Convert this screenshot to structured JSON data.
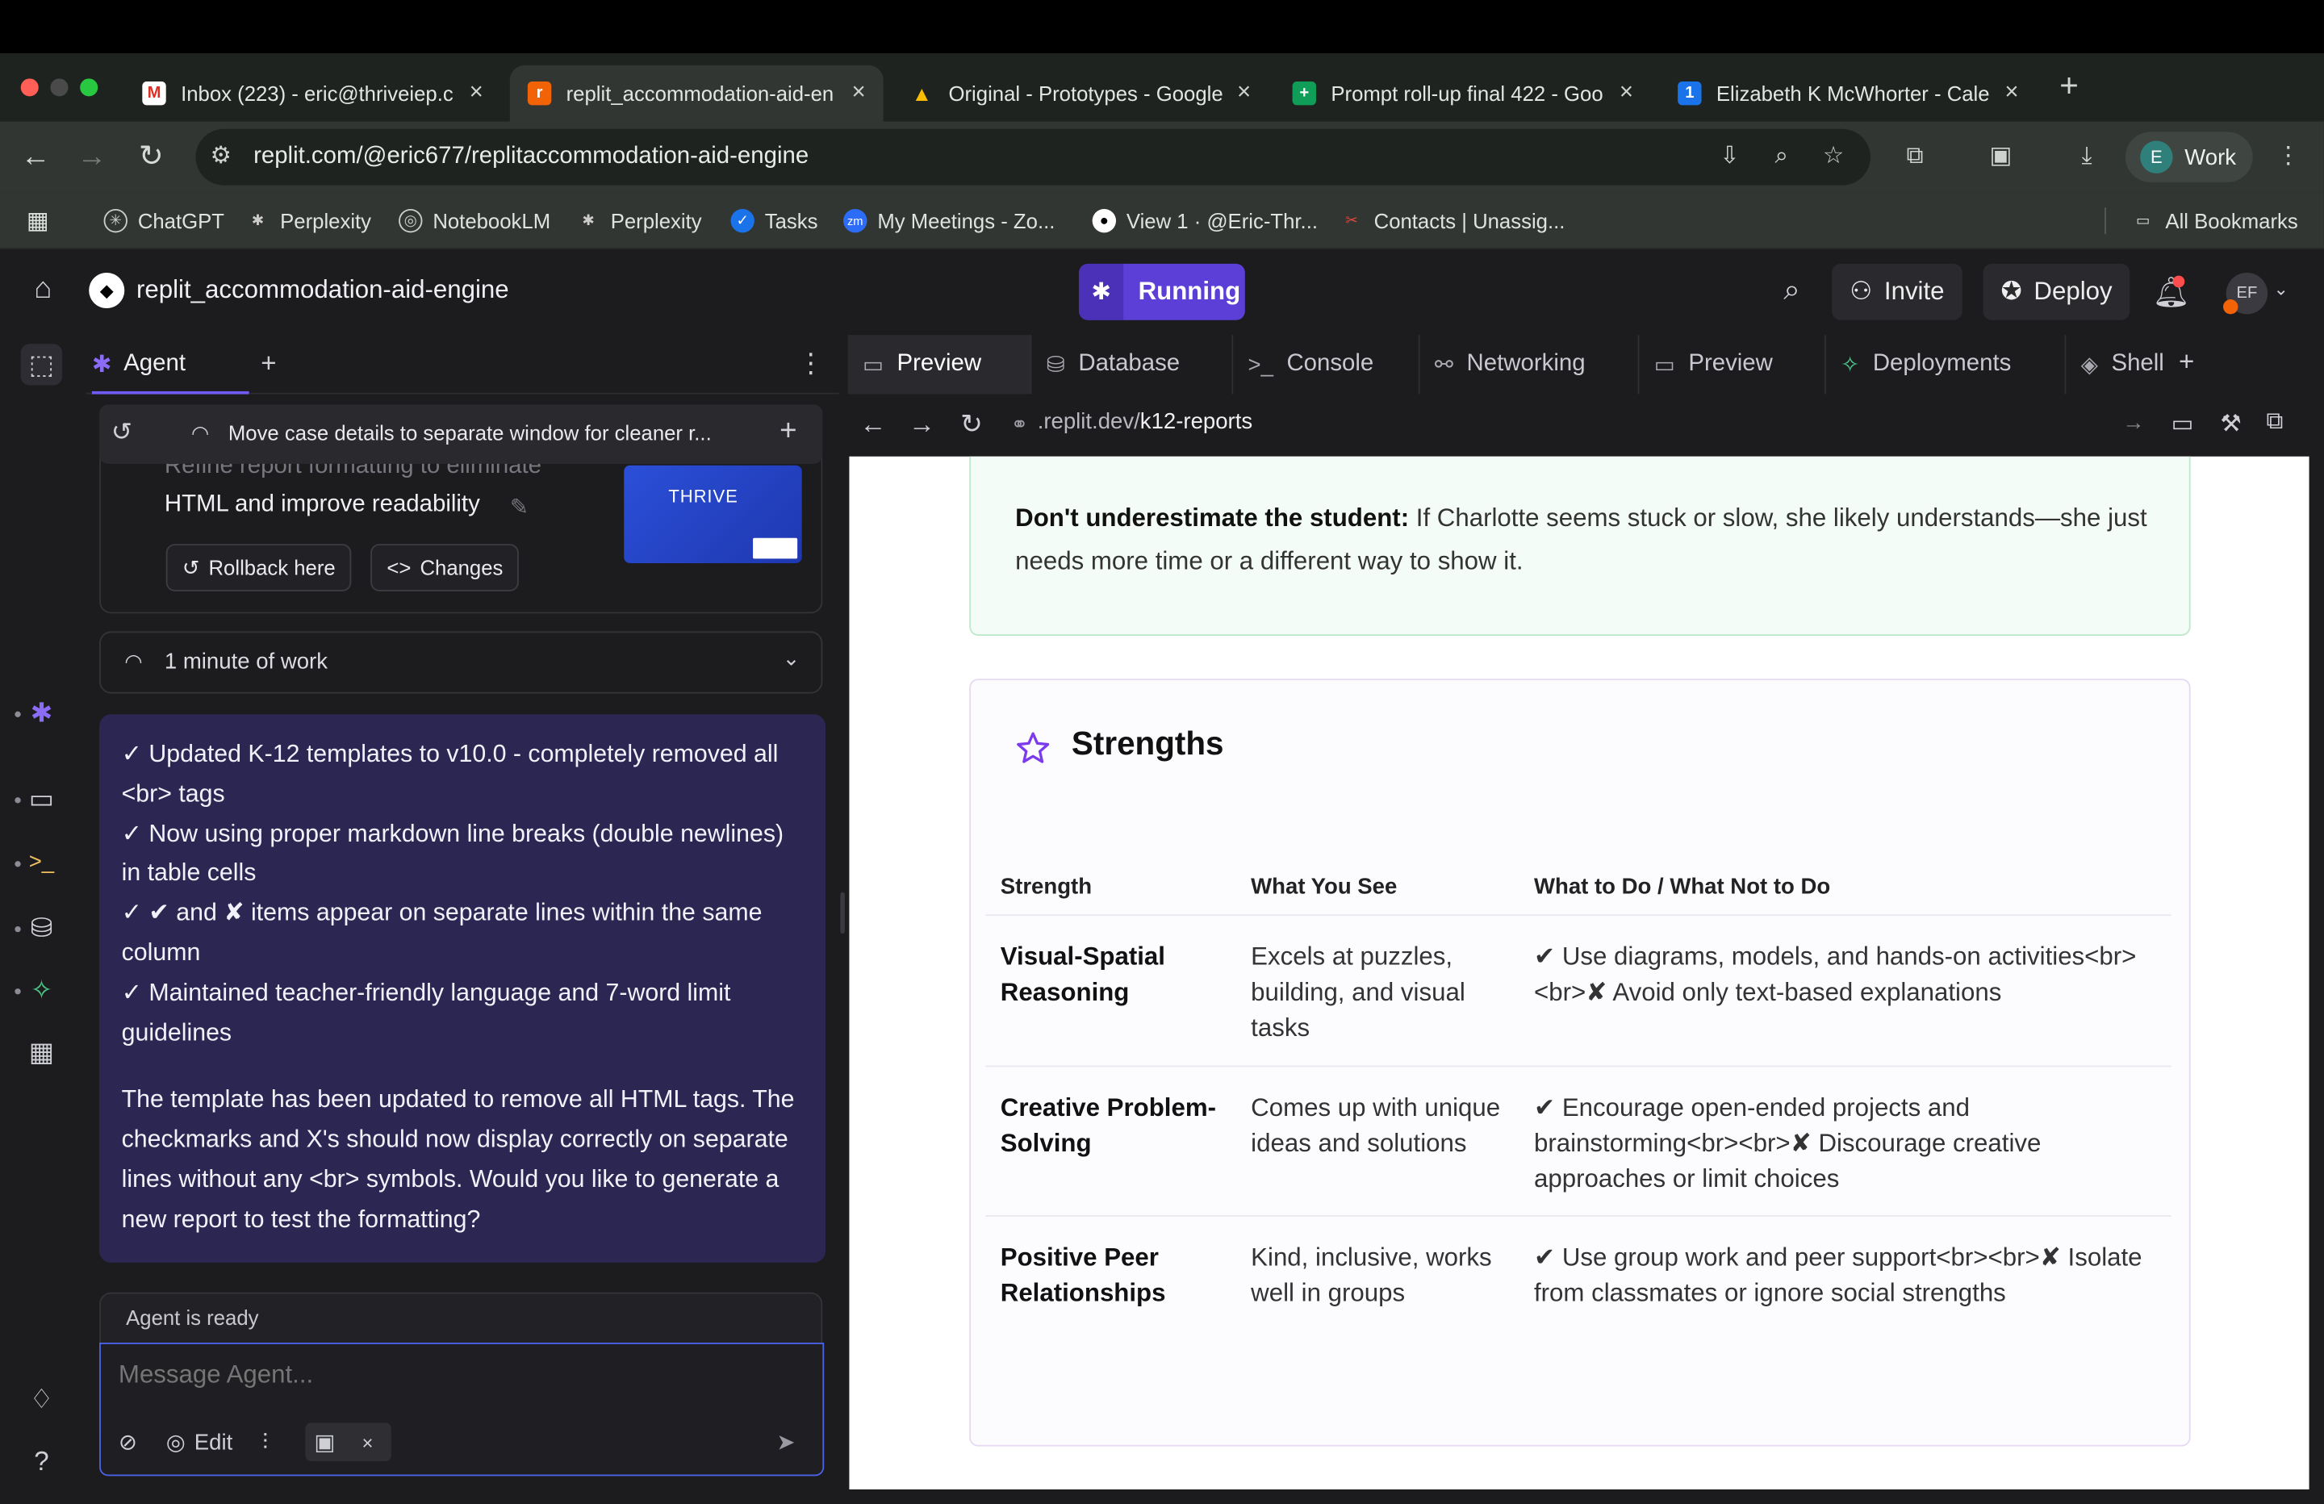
{
  "browser": {
    "tabs": [
      {
        "title": "Inbox (223) - eric@thriveiep.c",
        "color": "#d93025",
        "glyph": "M"
      },
      {
        "title": "replit_accommodation-aid-en",
        "color": "#f26207",
        "glyph": "r"
      },
      {
        "title": "Original - Prototypes - Google",
        "color": "#1a73e8",
        "glyph": "▲"
      },
      {
        "title": "Prompt roll-up final 422 - Goo",
        "color": "#0f9d58",
        "glyph": "+"
      },
      {
        "title": "Elizabeth K McWhorter - Cale",
        "color": "#1a73e8",
        "glyph": "1"
      }
    ],
    "url": "replit.com/@eric677/replitaccommodation-aid-engine",
    "profile_initial": "E",
    "profile_label": "Work",
    "bookmarks": [
      {
        "label": "ChatGPT",
        "color": "#444"
      },
      {
        "label": "Perplexity",
        "color": "#444"
      },
      {
        "label": "NotebookLM",
        "color": "#444"
      },
      {
        "label": "Perplexity",
        "color": "#444"
      },
      {
        "label": "Tasks",
        "color": "#1a73e8"
      },
      {
        "label": "My Meetings - Zo...",
        "color": "#2d6cf6"
      },
      {
        "label": "View 1 · @Eric-Thr...",
        "color": "#444"
      },
      {
        "label": "Contacts | Unassig...",
        "color": "#e8453c"
      }
    ],
    "all_bookmarks": "All Bookmarks"
  },
  "replit": {
    "project_title": "replit_accommodation-aid-engine",
    "run_status": "Running",
    "invite": "Invite",
    "deploy": "Deploy",
    "avatar_initials": "EF",
    "agent_tab": "Agent",
    "history_title": "Move case details to separate window for cleaner r...",
    "faded_text": "Refine report formatting to eliminate",
    "checkpoint_text": "HTML and improve readability",
    "rollback": "Rollback here",
    "changes": "Changes",
    "thumb_label": "THRIVE",
    "work_duration": "1 minute of work",
    "message_lines": [
      "✓ Updated K-12 templates to v10.0 - completely removed all <br> tags",
      "✓ Now using proper markdown line breaks (double newlines) in table cells",
      "✓ ✔ and ✘ items appear on separate lines within the same column",
      "✓ Maintained teacher-friendly language and 7-word limit guidelines"
    ],
    "message_paragraph": "The template has been updated to remove all HTML tags. The checkmarks and X's should now display correctly on separate lines without any <br> symbols. Would you like to generate a new report to test the formatting?",
    "agent_status": "Agent is ready",
    "input_placeholder": "Message Agent...",
    "edit_label": "Edit",
    "right_tabs": [
      "Preview",
      "Database",
      "Console",
      "Networking",
      "Preview",
      "Deployments",
      "Shell"
    ],
    "preview_url_prefix": ".replit.dev/",
    "preview_url_path": "k12-reports"
  },
  "report": {
    "tip_bold": "Don't underestimate the student:",
    "tip_text": " If Charlotte seems stuck or slow, she likely understands—she just needs more time or a different way to show it.",
    "section_title": "Strengths",
    "columns": [
      "Strength",
      "What You See",
      "What to Do / What Not to Do"
    ],
    "rows": [
      {
        "strength": "Visual-Spatial Reasoning",
        "see": "Excels at puzzles, building, and visual tasks",
        "todo": "✔ Use diagrams, models, and hands-on activities<br><br>✘ Avoid only text-based explanations"
      },
      {
        "strength": "Creative Problem-Solving",
        "see": "Comes up with unique ideas and solutions",
        "todo": "✔ Encourage open-ended projects and brainstorming<br><br>✘ Discourage creative approaches or limit choices"
      },
      {
        "strength": "Positive Peer Relationships",
        "see": "Kind, inclusive, works well in groups",
        "todo": "✔ Use group work and peer support<br><br>✘ Isolate from classmates or ignore social strengths"
      }
    ]
  },
  "colors": {
    "accent": "#5b3fd6",
    "agent_message_bg": "#2c2752",
    "input_border": "#4a63e6",
    "strength_star": "#7c3aed"
  }
}
